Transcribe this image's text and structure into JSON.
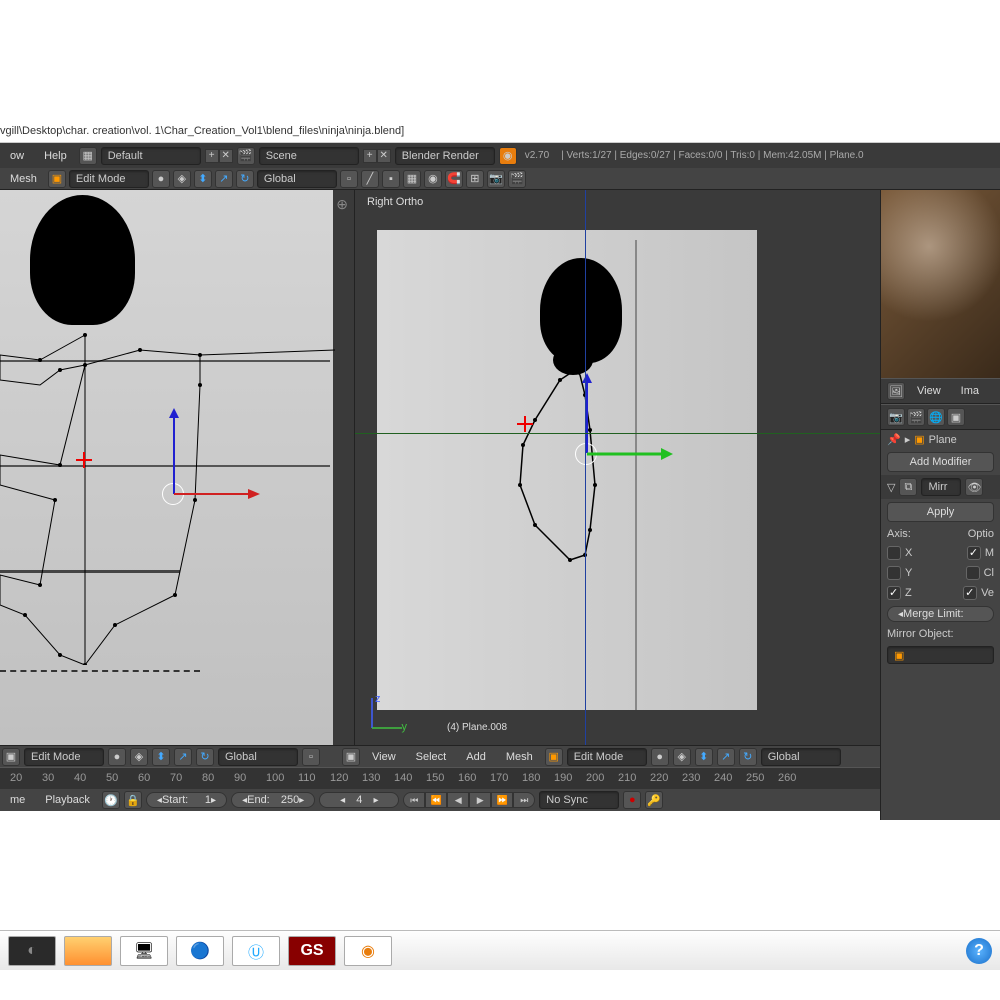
{
  "title_bar": "vgill\\Desktop\\char. creation\\vol. 1\\Char_Creation_Vol1\\blend_files\\ninja\\ninja.blend]",
  "info_bar": {
    "menu_help": "Help",
    "layout_name": "Default",
    "scene_name": "Scene",
    "render_engine": "Blender Render",
    "version": "v2.70",
    "stats": "| Verts:1/27 | Edges:0/27 | Faces:0/0 | Tris:0 | Mem:42.05M | Plane.0"
  },
  "toolbar": {
    "mesh_menu": "Mesh",
    "mode": "Edit Mode",
    "orientation": "Global"
  },
  "viewport_right": {
    "label": "Right Ortho",
    "object": "(4) Plane.008",
    "axis_z": "z",
    "axis_y": "y"
  },
  "bottom_header_left": {
    "mode": "Edit Mode",
    "orientation": "Global"
  },
  "bottom_header_right": {
    "view": "View",
    "select": "Select",
    "add": "Add",
    "mesh": "Mesh",
    "mode": "Edit Mode",
    "orientation": "Global"
  },
  "timeline_ticks": [
    "20",
    "30",
    "40",
    "50",
    "60",
    "70",
    "80",
    "90",
    "100",
    "110",
    "120",
    "130",
    "140",
    "150",
    "160",
    "170",
    "180",
    "190",
    "200",
    "210",
    "220",
    "230",
    "240",
    "250",
    "260"
  ],
  "timeline_controls": {
    "me": "me",
    "playback": "Playback",
    "start_label": "Start:",
    "start_val": "1",
    "end_label": "End:",
    "end_val": "250",
    "current": "4",
    "sync": "No Sync"
  },
  "properties": {
    "view": "View",
    "ima": "Ima",
    "plane": "Plane",
    "add_modifier": "Add Modifier",
    "mirr": "Mirr",
    "apply": "Apply",
    "axis_label": "Axis:",
    "options_label": "Optio",
    "x": "X",
    "y": "Y",
    "z": "Z",
    "m": "M",
    "cl": "Cl",
    "ve": "Ve",
    "merge_limit": "Merge Limit:",
    "mirror_object": "Mirror Object:"
  }
}
